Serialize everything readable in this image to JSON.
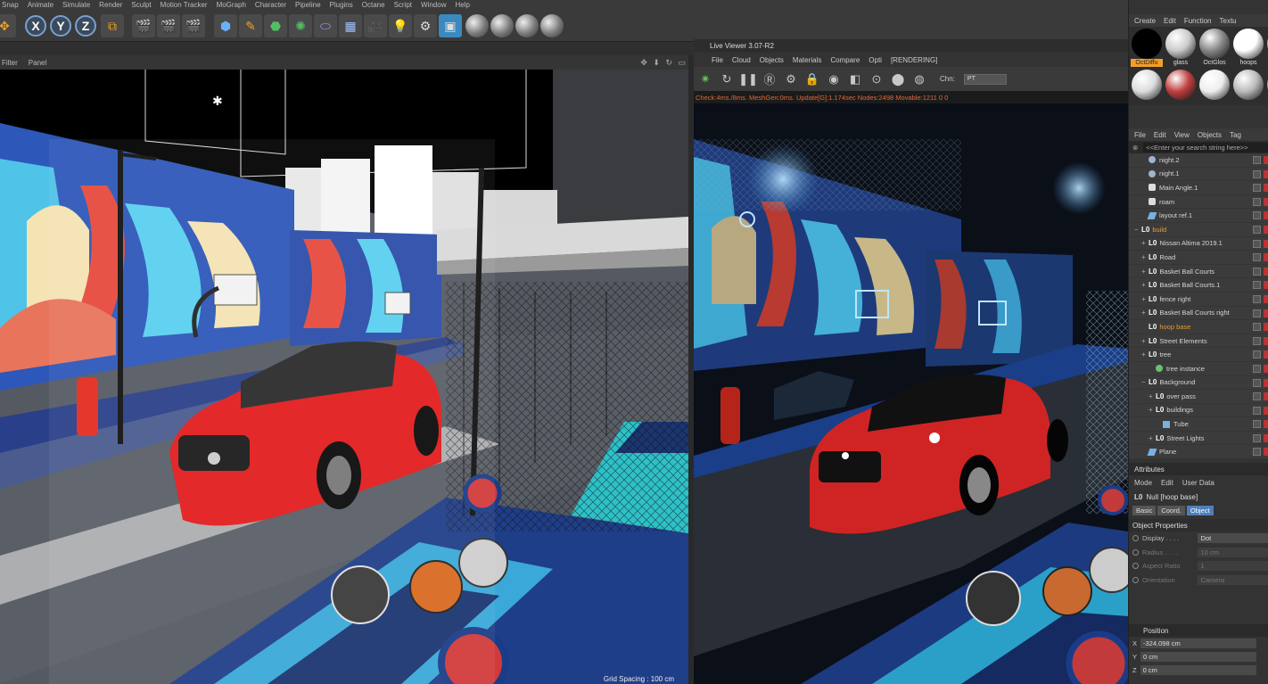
{
  "menubar": [
    "Snap",
    "Animate",
    "Simulate",
    "Render",
    "Sculpt",
    "Motion Tracker",
    "MoGraph",
    "Character",
    "Pipeline",
    "Plugins",
    "Octane",
    "Script",
    "Window",
    "Help"
  ],
  "toolbar": {
    "axis_x": "X",
    "axis_y": "Y",
    "axis_z": "Z"
  },
  "viewport": {
    "menu": [
      "Filter",
      "Panel"
    ],
    "nav_icons": "✥ ⬇ ↻ ▭",
    "grid_spacing": "Grid Spacing : 100 cm"
  },
  "live_viewer": {
    "title": "Live Viewer 3.07-R2",
    "menu": [
      "File",
      "Cloud",
      "Objects",
      "Materials",
      "Compare",
      "Opti",
      "[RENDERING]"
    ],
    "chn_label": "Chn:",
    "chn_value": "PT",
    "status": "Check:4ms./8ms. MeshGen:0ms. Update[G]:1.174sec Nodes:2498 Movable:1211  0 0"
  },
  "material_manager": {
    "menu": [
      "Create",
      "Edit",
      "Function",
      "Textu"
    ],
    "materials": [
      {
        "label": "OctDiffu",
        "selected": true,
        "color": "#000000"
      },
      {
        "label": "glass",
        "selected": false,
        "color": "#cccccc"
      },
      {
        "label": "OctGlos",
        "selected": false,
        "color": "#888888"
      },
      {
        "label": "hoops",
        "selected": false,
        "color": "#ffffff"
      },
      {
        "label": "",
        "selected": false,
        "color": "#aaaaaa"
      },
      {
        "label": "",
        "selected": false,
        "color": "#dddddd"
      },
      {
        "label": "",
        "selected": false,
        "color": "#c04040"
      },
      {
        "label": "",
        "selected": false,
        "color": "#eeeeee"
      },
      {
        "label": "",
        "selected": false,
        "color": "#bbbbbb"
      },
      {
        "label": "",
        "selected": false,
        "color": "#999999"
      }
    ]
  },
  "object_manager": {
    "menu": [
      "File",
      "Edit",
      "View",
      "Objects",
      "Tag"
    ],
    "search_placeholder": "<<Enter your search string here>>",
    "items": [
      {
        "label": "night.2",
        "icon": "sphere",
        "indent": 1,
        "expand": "",
        "orange": false
      },
      {
        "label": "night.1",
        "icon": "sphere",
        "indent": 1,
        "expand": "",
        "orange": false
      },
      {
        "label": "Main Angle.1",
        "icon": "camera",
        "indent": 1,
        "expand": "",
        "orange": false
      },
      {
        "label": "roam",
        "icon": "camera",
        "indent": 1,
        "expand": "",
        "orange": false
      },
      {
        "label": "layout ref.1",
        "icon": "plane",
        "indent": 1,
        "expand": "",
        "orange": false
      },
      {
        "label": "build",
        "icon": "null",
        "indent": 0,
        "expand": "−",
        "orange": true
      },
      {
        "label": "Nissan Altima 2019.1",
        "icon": "null",
        "indent": 1,
        "expand": "+",
        "orange": false
      },
      {
        "label": "Road",
        "icon": "null",
        "indent": 1,
        "expand": "+",
        "orange": false
      },
      {
        "label": "Basket Ball Courts",
        "icon": "null",
        "indent": 1,
        "expand": "+",
        "orange": false
      },
      {
        "label": "Basket Ball Courts.1",
        "icon": "null",
        "indent": 1,
        "expand": "+",
        "orange": false
      },
      {
        "label": "fence right",
        "icon": "null",
        "indent": 1,
        "expand": "+",
        "orange": false
      },
      {
        "label": "Basket Ball Courts right",
        "icon": "null",
        "indent": 1,
        "expand": "+",
        "orange": false
      },
      {
        "label": "hoop base",
        "icon": "null",
        "indent": 1,
        "expand": "",
        "orange": true
      },
      {
        "label": "Street Elements",
        "icon": "null",
        "indent": 1,
        "expand": "+",
        "orange": false
      },
      {
        "label": "tree",
        "icon": "null",
        "indent": 1,
        "expand": "+",
        "orange": false
      },
      {
        "label": "tree instance",
        "icon": "instance",
        "indent": 2,
        "expand": "",
        "orange": false
      },
      {
        "label": "Background",
        "icon": "null",
        "indent": 1,
        "expand": "−",
        "orange": false
      },
      {
        "label": "over pass",
        "icon": "null",
        "indent": 2,
        "expand": "+",
        "orange": false
      },
      {
        "label": "buildings",
        "icon": "null",
        "indent": 2,
        "expand": "+",
        "orange": false
      },
      {
        "label": "Tube",
        "icon": "tube",
        "indent": 3,
        "expand": "",
        "orange": false
      },
      {
        "label": "Street Lights",
        "icon": "null",
        "indent": 2,
        "expand": "+",
        "orange": false
      },
      {
        "label": "Plane",
        "icon": "plane",
        "indent": 1,
        "expand": "",
        "orange": false
      }
    ]
  },
  "attributes": {
    "header": "Attributes",
    "menu": [
      "Mode",
      "Edit",
      "User Data"
    ],
    "object_title": "Null [hoop base]",
    "tabs": [
      {
        "label": "Basic",
        "active": false
      },
      {
        "label": "Coord.",
        "active": false
      },
      {
        "label": "Object",
        "active": true
      }
    ],
    "section": "Object Properties",
    "props": [
      {
        "label": "Display . . . .",
        "value": "Dot",
        "dim": false
      },
      {
        "label": "Radius . . . .",
        "value": "10 cm",
        "dim": true
      },
      {
        "label": "Aspect Ratio",
        "value": "1",
        "dim": true
      },
      {
        "label": "Orientation",
        "value": "Camera",
        "dim": true
      }
    ],
    "position_header": "Position",
    "coords": [
      {
        "axis": "X",
        "value": "-324.098 cm"
      },
      {
        "axis": "Y",
        "value": "0 cm"
      },
      {
        "axis": "Z",
        "value": "0 cm"
      }
    ]
  }
}
